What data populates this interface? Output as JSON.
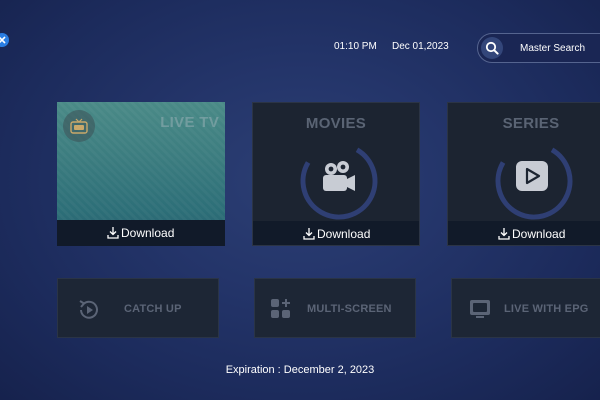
{
  "header": {
    "time": "01:10 PM",
    "date": "Dec 01,2023",
    "search_label": "Master Search"
  },
  "cards": [
    {
      "title": "LIVE TV",
      "action_label": "Download"
    },
    {
      "title": "MOVIES",
      "action_label": "Download"
    },
    {
      "title": "SERIES",
      "action_label": "Download"
    }
  ],
  "secondary": [
    {
      "label": "CATCH UP"
    },
    {
      "label": "MULTI-SCREEN"
    },
    {
      "label": "LIVE WITH EPG"
    }
  ],
  "footer": {
    "expiration": "Expiration : December 2, 2023"
  },
  "colors": {
    "background": "#24356a",
    "card": "#1c2431",
    "card_footer": "#111a29",
    "muted_text": "#5b6476",
    "ring_accent": "#2f3f74"
  }
}
